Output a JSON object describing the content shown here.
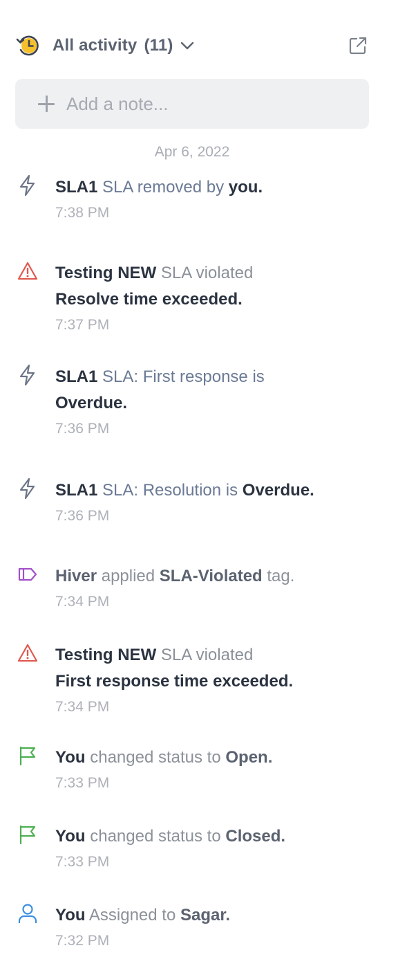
{
  "header": {
    "title": "All activity",
    "count": "(11)",
    "history_icon": "history-clock-icon",
    "expand_icon": "external-link-icon"
  },
  "note": {
    "placeholder": "Add a note..."
  },
  "date_header": "Apr 6, 2022",
  "colors": {
    "bolt": "#6b7587",
    "warning": "#e0594f",
    "tag": "#a24fc9",
    "flag": "#4caf50",
    "user": "#3b8fe0",
    "clock_face": "#f5c02b"
  },
  "activities": [
    {
      "icon": "bolt-icon",
      "p1": "SLA1",
      "p2": " SLA removed by ",
      "p3": "you.",
      "time": "7:38 PM"
    },
    {
      "icon": "warning-icon",
      "p1": "Testing NEW",
      "p2": " SLA violated",
      "line2": "Resolve time exceeded.",
      "time": "7:37 PM"
    },
    {
      "icon": "bolt-icon",
      "p1": "SLA1",
      "p2": " SLA: First response is",
      "line2": "Overdue.",
      "time": "7:36 PM"
    },
    {
      "icon": "bolt-icon",
      "p1": "SLA1",
      "p2": " SLA: Resolution is ",
      "p3": "Overdue.",
      "time": "7:36 PM"
    },
    {
      "icon": "tag-icon",
      "p1": "Hiver",
      "p2": " applied ",
      "p3": "SLA-Violated",
      "p4": " tag.",
      "time": "7:34 PM"
    },
    {
      "icon": "warning-icon",
      "p1": "Testing NEW",
      "p2": " SLA violated",
      "line2": "First response time exceeded.",
      "time": "7:34 PM"
    },
    {
      "icon": "flag-icon",
      "p1": "You",
      "p2": " changed status to ",
      "p3": "Open.",
      "time": "7:33 PM"
    },
    {
      "icon": "flag-icon",
      "p1": "You",
      "p2": " changed status to ",
      "p3": "Closed.",
      "time": "7:33 PM"
    },
    {
      "icon": "user-icon",
      "p1": "You",
      "p2": " Assigned to ",
      "p3": "Sagar.",
      "time": "7:32 PM"
    }
  ]
}
